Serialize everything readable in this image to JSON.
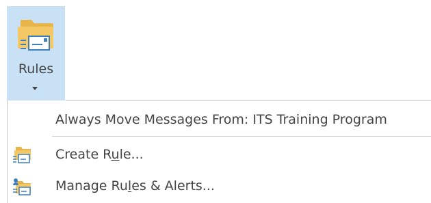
{
  "ribbon": {
    "rules_label": "Rules",
    "rules_icon": "rules-folder-icon"
  },
  "menu": {
    "always_move_label": "Always Move Messages From: ITS Training Program",
    "create_rule": {
      "prefix": "Create R",
      "accel": "u",
      "suffix": "le...",
      "icon": "create-rule-icon"
    },
    "manage_rules": {
      "prefix": "Manage Ru",
      "accel": "l",
      "suffix": "es & Alerts...",
      "icon": "manage-rules-icon"
    }
  },
  "colors": {
    "button_pressed_bg": "#c9e1f5",
    "menu_border": "#c6c6c6",
    "text": "#444444",
    "folder": "#f5c866"
  }
}
